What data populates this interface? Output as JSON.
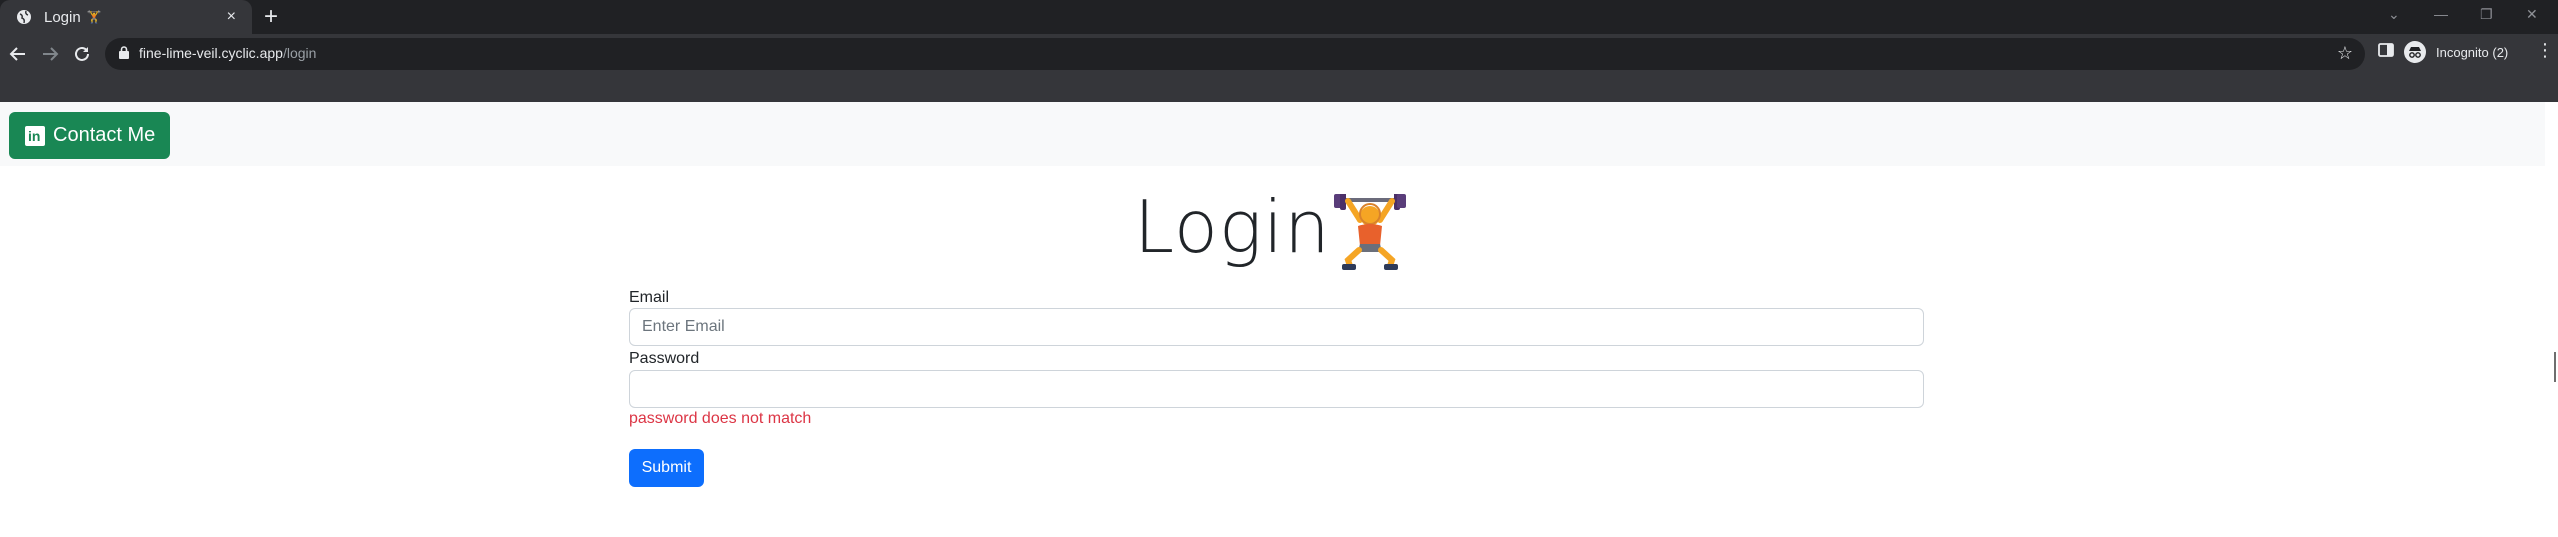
{
  "browser": {
    "tab": {
      "title": "Login",
      "title_emoji": "🏋",
      "close": "×"
    },
    "new_tab": "+",
    "window_controls": {
      "tab_search": "⌄",
      "minimize": "—",
      "restore": "❐",
      "close": "✕"
    },
    "address": {
      "host": "fine-lime-veil.cyclic.app",
      "path": "/login"
    },
    "profile_label": "Incognito (2)",
    "menu": "⋮"
  },
  "navbar": {
    "contact_label": "Contact Me",
    "contact_icon_text": "in"
  },
  "page": {
    "title": "Login",
    "email_label": "Email",
    "email_placeholder": "Enter Email",
    "password_label": "Password",
    "password_value": "",
    "error_message": "password does not match",
    "submit_label": "Submit"
  },
  "colors": {
    "primary": "#0d6efd",
    "success": "#198754",
    "danger": "#dc3545",
    "navbar_bg": "#f8f9fa",
    "chrome_bg": "#35363a"
  }
}
